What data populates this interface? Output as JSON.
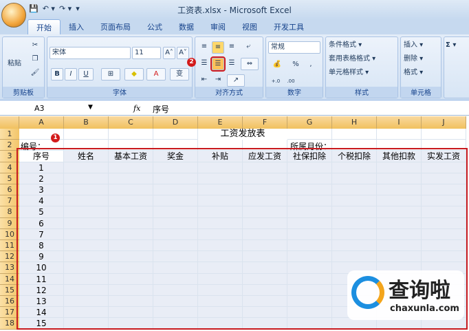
{
  "window": {
    "title": "工资表.xlsx - Microsoft Excel"
  },
  "qat": {
    "save": "💾",
    "undo": "↶ ▾",
    "redo": "↷ ▾",
    "more": "▾"
  },
  "tabs": [
    "开始",
    "插入",
    "页面布局",
    "公式",
    "数据",
    "审阅",
    "视图",
    "开发工具"
  ],
  "ribbon": {
    "clipboard": {
      "label": "剪贴板",
      "paste": "粘贴"
    },
    "font": {
      "label": "字体",
      "name": "宋体",
      "size": "11",
      "grow": "A˄",
      "shrink": "A˅",
      "bold": "B",
      "italic": "I",
      "underline": "U",
      "border": "⊞",
      "fill": "◆",
      "color": "A",
      "wen": "变"
    },
    "align": {
      "label": "对齐方式"
    },
    "number": {
      "label": "数字",
      "format": "常规",
      "percent": "%",
      "comma": ",",
      "inc": "+.0 .00",
      "dec": ".00 →.0"
    },
    "styles": {
      "label": "样式",
      "cond": "条件格式 ▾",
      "table": "套用表格格式 ▾",
      "cell": "单元格样式 ▾"
    },
    "cells": {
      "label": "单元格",
      "insert": "插入 ▾",
      "delete": "删除 ▾",
      "format": "格式 ▾"
    },
    "edit": {
      "sigma": "Σ ▾"
    }
  },
  "formula": {
    "namebox": "A3",
    "fx": "fx",
    "value": "序号"
  },
  "columns": [
    "A",
    "B",
    "C",
    "D",
    "E",
    "F",
    "G",
    "H",
    "I",
    "J"
  ],
  "rows": [
    "1",
    "2",
    "3",
    "4",
    "5",
    "6",
    "7",
    "8",
    "9",
    "10",
    "11",
    "12",
    "13",
    "14",
    "15",
    "16",
    "17",
    "18"
  ],
  "sheet": {
    "title": "工资发放表",
    "label_no": "编号：",
    "label_month": "所属月份：",
    "headers": [
      "序号",
      "姓名",
      "基本工资",
      "奖金",
      "补贴",
      "应发工资",
      "社保扣除",
      "个税扣除",
      "其他扣款",
      "实发工资"
    ],
    "serials": [
      "1",
      "2",
      "3",
      "4",
      "5",
      "6",
      "7",
      "8",
      "9",
      "10",
      "11",
      "12",
      "13",
      "14",
      "15"
    ]
  },
  "badges": [
    "1",
    "2"
  ],
  "watermark": {
    "brand": "查询啦",
    "url": "chaxunla.com"
  }
}
